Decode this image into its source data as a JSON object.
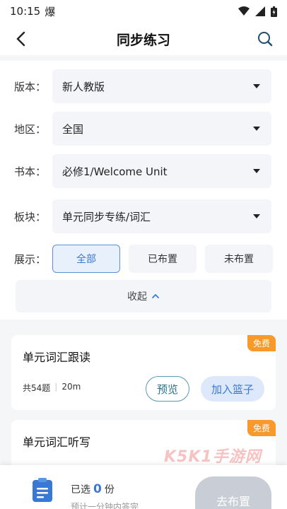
{
  "status_bar": {
    "time": "10:15",
    "net_glyph": "爆"
  },
  "header": {
    "title": "同步练习"
  },
  "filters": {
    "edition": {
      "label": "版本：",
      "value": "新人教版"
    },
    "region": {
      "label": "地区：",
      "value": "全国"
    },
    "book": {
      "label": "书本：",
      "value": "必修1/Welcome Unit"
    },
    "section": {
      "label": "板块：",
      "value": "单元同步专练/词汇"
    },
    "display": {
      "label": "展示：",
      "options": [
        "全部",
        "已布置",
        "未布置"
      ],
      "selected": "全部"
    },
    "collapse_label": "收起"
  },
  "cards": [
    {
      "title": "单元词汇跟读",
      "badge": "免费",
      "count": "共54题",
      "duration": "20m",
      "preview_label": "预览",
      "add_label": "加入篮子"
    },
    {
      "title": "单元词汇听写",
      "badge": "免费"
    }
  ],
  "bottom_bar": {
    "selected_prefix": "已选",
    "selected_count": "0",
    "selected_suffix": "份",
    "estimate": "预计一分钟内答完",
    "assign_label": "去布置"
  },
  "watermark": "K5K1手游网",
  "colors": {
    "accent": "#3a78d6",
    "badge": "#f79a2b"
  }
}
